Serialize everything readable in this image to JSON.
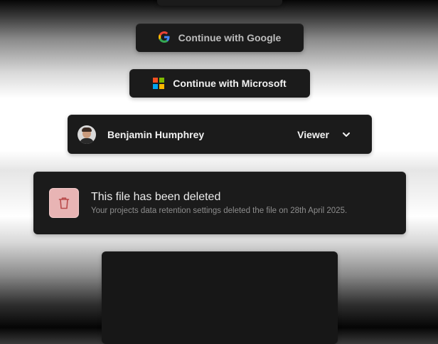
{
  "buttons": {
    "google_label": "Continue with Google",
    "microsoft_label": "Continue with Microsoft"
  },
  "user_row": {
    "name": "Benjamin Humphrey",
    "role": "Viewer"
  },
  "notice": {
    "title": "This file has been deleted",
    "subtitle": "Your projects data retention settings deleted the file on 28th April 2025."
  },
  "icons": {
    "google": "google-logo-icon",
    "microsoft": "microsoft-logo-icon",
    "chevron": "chevron-down-icon",
    "trash": "trash-icon"
  },
  "colors": {
    "card_bg": "#1b1b1b",
    "danger_bg": "#e8b4b4",
    "danger_icon": "#b94a4a",
    "google_blue": "#4285F4",
    "google_red": "#EA4335",
    "google_yellow": "#FBBC05",
    "google_green": "#34A853",
    "ms_red": "#F25022",
    "ms_green": "#7FBA00",
    "ms_blue": "#00A4EF",
    "ms_yellow": "#FFB900"
  }
}
